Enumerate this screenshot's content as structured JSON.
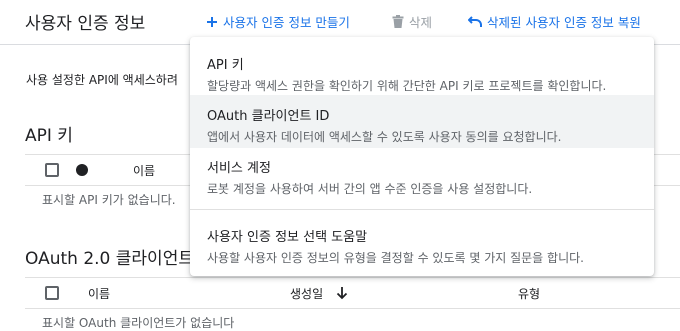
{
  "header": {
    "title": "사용자 인증 정보",
    "create_label": "사용자 인증 정보 만들기",
    "delete_label": "삭제",
    "restore_label": "삭제된 사용자 인증 정보 복원"
  },
  "page": {
    "description": "사용 설정한 API에 액세스하려",
    "api_keys": {
      "title": "API 키",
      "col_name": "이름",
      "empty": "표시할 API 키가 없습니다."
    },
    "oauth": {
      "title": "OAuth 2.0 클라이언트",
      "col_name": "이름",
      "col_created": "생성일",
      "col_type": "유형",
      "empty": "표시할 OAuth 클라이언트가 없습니다"
    }
  },
  "menu": {
    "items": [
      {
        "title": "API 키",
        "desc": "할당량과 액세스 권한을 확인하기 위해 간단한 API 키로 프로젝트를 확인합니다."
      },
      {
        "title": "OAuth 클라이언트 ID",
        "desc": "앱에서 사용자 데이터에 액세스할 수 있도록 사용자 동의를 요청합니다."
      },
      {
        "title": "서비스 계정",
        "desc": "로봇 계정을 사용하여 서버 간의 앱 수준 인증을 사용 설정합니다."
      },
      {
        "title": "사용자 인증 정보 선택 도움말",
        "desc": "사용할 사용자 인증 정보의 유형을 결정할 수 있도록 몇 가지 질문을 합니다."
      }
    ]
  },
  "icons": {
    "create": "plus-icon",
    "delete": "trash-icon",
    "restore": "undo-icon",
    "sort": "arrow-down-icon"
  },
  "colors": {
    "accent": "#1a73e8",
    "disabled": "#9aa0a6"
  }
}
